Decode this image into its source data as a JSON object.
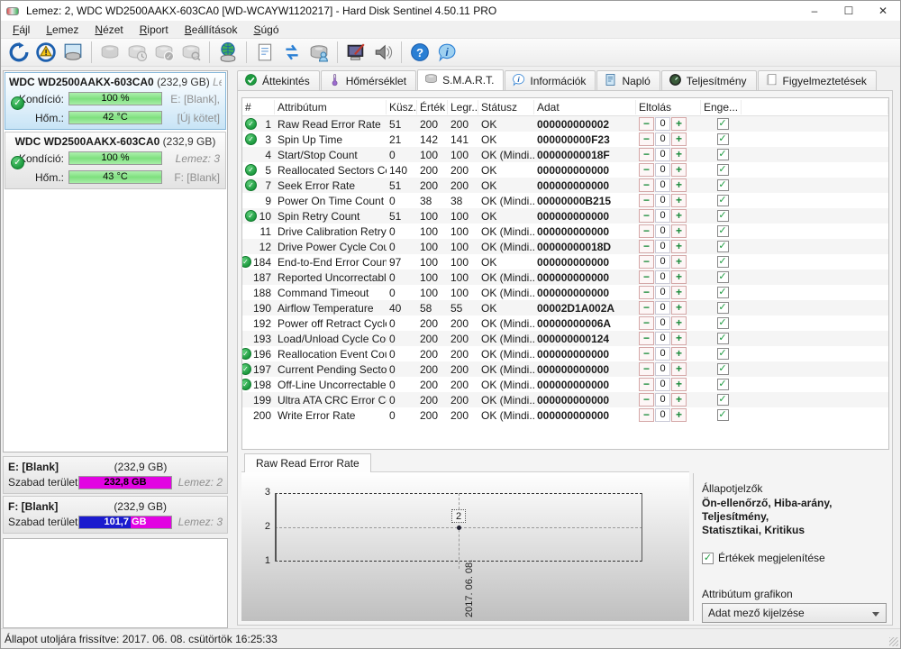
{
  "window": {
    "title": "Lemez: 2, WDC WD2500AAKX-603CA0 [WD-WCAYW1120217]  -  Hard Disk Sentinel 4.50.11 PRO",
    "controls": {
      "minimize": "–",
      "maximize": "☐",
      "close": "✕"
    }
  },
  "menu": {
    "items": [
      "Fájl",
      "Lemez",
      "Nézet",
      "Riport",
      "Beállítások",
      "Súgó"
    ]
  },
  "toolbar": {
    "groups": [
      [
        {
          "name": "refresh-icon",
          "disabled": false
        },
        {
          "name": "report-problem-icon",
          "disabled": false
        },
        {
          "name": "disk-monitor-icon",
          "disabled": false
        }
      ],
      [
        {
          "name": "disk-offline-icon",
          "disabled": true
        },
        {
          "name": "disk-clock-icon",
          "disabled": true
        },
        {
          "name": "disk-accept-icon",
          "disabled": true
        },
        {
          "name": "disk-search-icon",
          "disabled": true
        }
      ],
      [
        {
          "name": "network-disk-icon",
          "disabled": false
        }
      ],
      [
        {
          "name": "report-icon",
          "disabled": false
        },
        {
          "name": "refresh-data-icon",
          "disabled": false
        },
        {
          "name": "share-icon",
          "disabled": false
        }
      ],
      [
        {
          "name": "surface-test-icon",
          "disabled": false
        },
        {
          "name": "sound-icon",
          "disabled": false
        }
      ],
      [
        {
          "name": "help-icon",
          "disabled": false
        },
        {
          "name": "info-icon",
          "disabled": false
        }
      ]
    ]
  },
  "sidebar": {
    "disks": [
      {
        "model": "WDC WD2500AAKX-603CA0",
        "size": "(232,9 GB)",
        "corner": "Len",
        "cond_label": "Kondíció:",
        "cond_value": "100 %",
        "cond_note": "E: [Blank],",
        "cond_note_italic": false,
        "temp_label": "Hőm.:",
        "temp_value": "42 °C",
        "temp_note": "[Új kötet]",
        "selected": true
      },
      {
        "model": "WDC WD2500AAKX-603CA0",
        "size": "(232,9 GB)",
        "corner": "",
        "cond_label": "Kondíció:",
        "cond_value": "100 %",
        "cond_note": "Lemez: 3",
        "cond_note_italic": true,
        "temp_label": "Hőm.:",
        "temp_value": "43 °C",
        "temp_note": "F: [Blank]",
        "selected": false
      }
    ],
    "volumes": [
      {
        "name": "E: [Blank]",
        "size": "(232,9 GB)",
        "free_label": "Szabad terület",
        "free_value": "232,8 GB",
        "disk_note": "Lemez: 2",
        "used_pct": 0,
        "text_color": "#000000"
      },
      {
        "name": "F: [Blank]",
        "size": "(232,9 GB)",
        "free_label": "Szabad terület",
        "free_value": "101,7 GB",
        "disk_note": "Lemez: 3",
        "used_pct": 56,
        "text_color": "#ffffff"
      }
    ]
  },
  "tabs": [
    {
      "label": "Áttekintés",
      "icon": "check-circle-icon",
      "active": false
    },
    {
      "label": "Hőmérséklet",
      "icon": "thermometer-icon",
      "active": false
    },
    {
      "label": "S.M.A.R.T.",
      "icon": "disk-icon",
      "active": true
    },
    {
      "label": "Információk",
      "icon": "info-balloon-icon",
      "active": false
    },
    {
      "label": "Napló",
      "icon": "log-icon",
      "active": false
    },
    {
      "label": "Teljesítmény",
      "icon": "performance-icon",
      "active": false
    },
    {
      "label": "Figyelmeztetések",
      "icon": "alerts-icon",
      "active": false
    }
  ],
  "smart_table": {
    "columns": [
      "#",
      "Attribútum",
      "Küsz...",
      "Érték",
      "Legr...",
      "Státusz",
      "Adat",
      "Eltolás",
      "Enge..."
    ],
    "offset_minus": "−",
    "offset_plus": "+",
    "offset_value": "0",
    "check_glyph": "✓",
    "rows": [
      {
        "id": "1",
        "ok": true,
        "name": "Raw Read Error Rate",
        "thr": "51",
        "val": "200",
        "worst": "200",
        "status": "OK",
        "data": "000000000002"
      },
      {
        "id": "3",
        "ok": true,
        "name": "Spin Up Time",
        "thr": "21",
        "val": "142",
        "worst": "141",
        "status": "OK",
        "data": "000000000F23"
      },
      {
        "id": "4",
        "ok": false,
        "name": "Start/Stop Count",
        "thr": "0",
        "val": "100",
        "worst": "100",
        "status": "OK (Mindi...",
        "data": "00000000018F"
      },
      {
        "id": "5",
        "ok": true,
        "name": "Reallocated Sectors Co...",
        "thr": "140",
        "val": "200",
        "worst": "200",
        "status": "OK",
        "data": "000000000000"
      },
      {
        "id": "7",
        "ok": true,
        "name": "Seek Error Rate",
        "thr": "51",
        "val": "200",
        "worst": "200",
        "status": "OK",
        "data": "000000000000"
      },
      {
        "id": "9",
        "ok": false,
        "name": "Power On Time Count",
        "thr": "0",
        "val": "38",
        "worst": "38",
        "status": "OK (Mindi...",
        "data": "00000000B215"
      },
      {
        "id": "10",
        "ok": true,
        "name": "Spin Retry Count",
        "thr": "51",
        "val": "100",
        "worst": "100",
        "status": "OK",
        "data": "000000000000"
      },
      {
        "id": "11",
        "ok": false,
        "name": "Drive Calibration Retry ...",
        "thr": "0",
        "val": "100",
        "worst": "100",
        "status": "OK (Mindi...",
        "data": "000000000000"
      },
      {
        "id": "12",
        "ok": false,
        "name": "Drive Power Cycle Count",
        "thr": "0",
        "val": "100",
        "worst": "100",
        "status": "OK (Mindi...",
        "data": "00000000018D"
      },
      {
        "id": "184",
        "ok": true,
        "name": "End-to-End Error Count",
        "thr": "97",
        "val": "100",
        "worst": "100",
        "status": "OK",
        "data": "000000000000"
      },
      {
        "id": "187",
        "ok": false,
        "name": "Reported Uncorrectabl...",
        "thr": "0",
        "val": "100",
        "worst": "100",
        "status": "OK (Mindi...",
        "data": "000000000000"
      },
      {
        "id": "188",
        "ok": false,
        "name": "Command Timeout",
        "thr": "0",
        "val": "100",
        "worst": "100",
        "status": "OK (Mindi...",
        "data": "000000000000"
      },
      {
        "id": "190",
        "ok": false,
        "name": "Airflow Temperature",
        "thr": "40",
        "val": "58",
        "worst": "55",
        "status": "OK",
        "data": "00002D1A002A"
      },
      {
        "id": "192",
        "ok": false,
        "name": "Power off Retract Cycle ...",
        "thr": "0",
        "val": "200",
        "worst": "200",
        "status": "OK (Mindi...",
        "data": "00000000006A"
      },
      {
        "id": "193",
        "ok": false,
        "name": "Load/Unload Cycle Cou...",
        "thr": "0",
        "val": "200",
        "worst": "200",
        "status": "OK (Mindi...",
        "data": "000000000124"
      },
      {
        "id": "196",
        "ok": true,
        "name": "Reallocation Event Count",
        "thr": "0",
        "val": "200",
        "worst": "200",
        "status": "OK (Mindi...",
        "data": "000000000000"
      },
      {
        "id": "197",
        "ok": true,
        "name": "Current Pending Sector...",
        "thr": "0",
        "val": "200",
        "worst": "200",
        "status": "OK (Mindi...",
        "data": "000000000000"
      },
      {
        "id": "198",
        "ok": true,
        "name": "Off-Line Uncorrectable ...",
        "thr": "0",
        "val": "200",
        "worst": "200",
        "status": "OK (Mindi...",
        "data": "000000000000"
      },
      {
        "id": "199",
        "ok": false,
        "name": "Ultra ATA CRC Error Co...",
        "thr": "0",
        "val": "200",
        "worst": "200",
        "status": "OK (Mindi...",
        "data": "000000000000"
      },
      {
        "id": "200",
        "ok": false,
        "name": "Write Error Rate",
        "thr": "0",
        "val": "200",
        "worst": "200",
        "status": "OK (Mindi...",
        "data": "000000000000"
      }
    ]
  },
  "chart_section": {
    "tab_label": "Raw Read Error Rate"
  },
  "chart_data": {
    "type": "line",
    "title": "Raw Read Error Rate",
    "x": [
      "2017. 06. 08."
    ],
    "values": [
      2
    ],
    "point_labels": [
      "2"
    ],
    "yticks": [
      3,
      2,
      1
    ],
    "ylim": [
      1,
      3
    ],
    "grid": "dashed",
    "legend": "none"
  },
  "right_panel": {
    "header": "Állapotjelzők",
    "flags_line1": "Ön-ellenőrző, Hiba-arány, Teljesítmény,",
    "flags_line2": "Statisztikai, Kritikus",
    "show_values_label": "Értékek megjelenítése",
    "show_values_checked": true,
    "check_glyph": "✓",
    "graph_label": "Attribútum grafikon",
    "graph_select_value": "Adat mező kijelzése"
  },
  "status_bar": {
    "text": "Állapot utoljára frissítve: 2017. 06. 08. csütörtök 16:25:33"
  },
  "colors": {
    "accent_green": "#1d9a3f",
    "bar_green": "#8ae68a",
    "free_magenta": "#e203e2",
    "used_blue": "#1b1bce",
    "selected_border": "#86b7d9"
  }
}
